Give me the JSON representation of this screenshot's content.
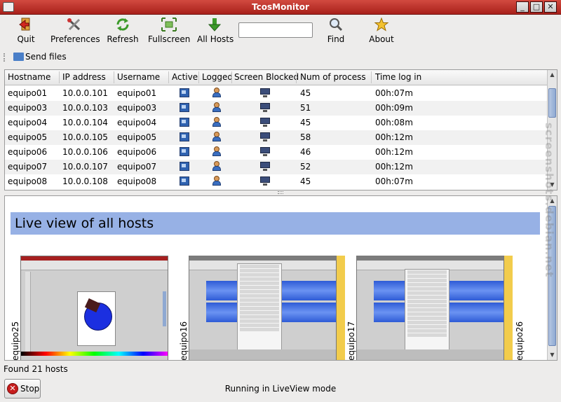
{
  "window": {
    "title": "TcosMonitor",
    "buttons": [
      "_",
      "□",
      "✕"
    ]
  },
  "toolbar": {
    "items": [
      {
        "label": "Quit",
        "icon": "quit-icon"
      },
      {
        "label": "Preferences",
        "icon": "preferences-icon"
      },
      {
        "label": "Refresh",
        "icon": "refresh-icon"
      },
      {
        "label": "Fullscreen",
        "icon": "fullscreen-icon"
      },
      {
        "label": "All Hosts",
        "icon": "all-hosts-icon"
      },
      {
        "label": "Find",
        "icon": "find-icon"
      },
      {
        "label": "About",
        "icon": "about-icon"
      }
    ],
    "search_value": ""
  },
  "sendbar": {
    "label": "Send files"
  },
  "table": {
    "columns": [
      "Hostname",
      "IP address",
      "Username",
      "Active",
      "Logged",
      "Screen Blocked",
      "Num of process",
      "Time log in"
    ],
    "rows": [
      {
        "hostname": "equipo01",
        "ip": "10.0.0.101",
        "username": "equipo01",
        "processes": "45",
        "time": "00h:07m"
      },
      {
        "hostname": "equipo03",
        "ip": "10.0.0.103",
        "username": "equipo03",
        "processes": "51",
        "time": "00h:09m"
      },
      {
        "hostname": "equipo04",
        "ip": "10.0.0.104",
        "username": "equipo04",
        "processes": "45",
        "time": "00h:08m"
      },
      {
        "hostname": "equipo05",
        "ip": "10.0.0.105",
        "username": "equipo05",
        "processes": "58",
        "time": "00h:12m"
      },
      {
        "hostname": "equipo06",
        "ip": "10.0.0.106",
        "username": "equipo06",
        "processes": "46",
        "time": "00h:12m"
      },
      {
        "hostname": "equipo07",
        "ip": "10.0.0.107",
        "username": "equipo07",
        "processes": "52",
        "time": "00h:12m"
      },
      {
        "hostname": "equipo08",
        "ip": "10.0.0.108",
        "username": "equipo08",
        "processes": "45",
        "time": "00h:07m"
      }
    ]
  },
  "liveview": {
    "title": "Live view of all hosts",
    "hosts": [
      "equipo25",
      "equipo16",
      "equipo17",
      "equipo26"
    ]
  },
  "status": {
    "found": "Found 21 hosts",
    "mode": "Running in LiveView mode"
  },
  "stop_button": {
    "label": "Stop"
  },
  "watermark": "screenshots.debian.net",
  "colors": {
    "titlebar": "#b8302a",
    "banner": "#97b1e5",
    "yellow_strip": "#f2cc4c"
  }
}
